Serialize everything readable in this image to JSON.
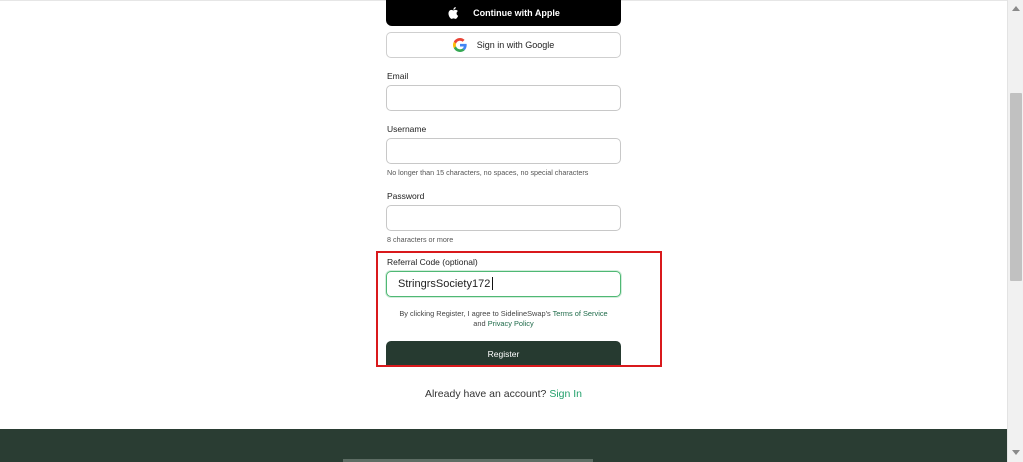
{
  "auth": {
    "apple_label": "Continue with Apple",
    "google_label": "Sign in with Google"
  },
  "form": {
    "email_label": "Email",
    "email_value": "",
    "username_label": "Username",
    "username_value": "",
    "username_help": "No longer than 15 characters, no spaces, no special characters",
    "password_label": "Password",
    "password_value": "",
    "password_help": "8 characters or more",
    "referral_label": "Referral Code (optional)",
    "referral_value": "StringrsSociety172",
    "terms_prefix": "By clicking Register, I agree to SidelineSwap's",
    "terms_link": "Terms of Service",
    "terms_and": "and",
    "privacy_link": "Privacy Policy",
    "register_label": "Register"
  },
  "footer_prompt": {
    "text": "Already have an account?",
    "signin_label": "Sign In"
  },
  "colors": {
    "primary_dark": "#263a30",
    "accent_green": "#22a06b",
    "focus_green": "#4fb874",
    "highlight_red": "#d9191c"
  },
  "icons": {
    "apple": "apple-icon",
    "google": "google-icon"
  }
}
